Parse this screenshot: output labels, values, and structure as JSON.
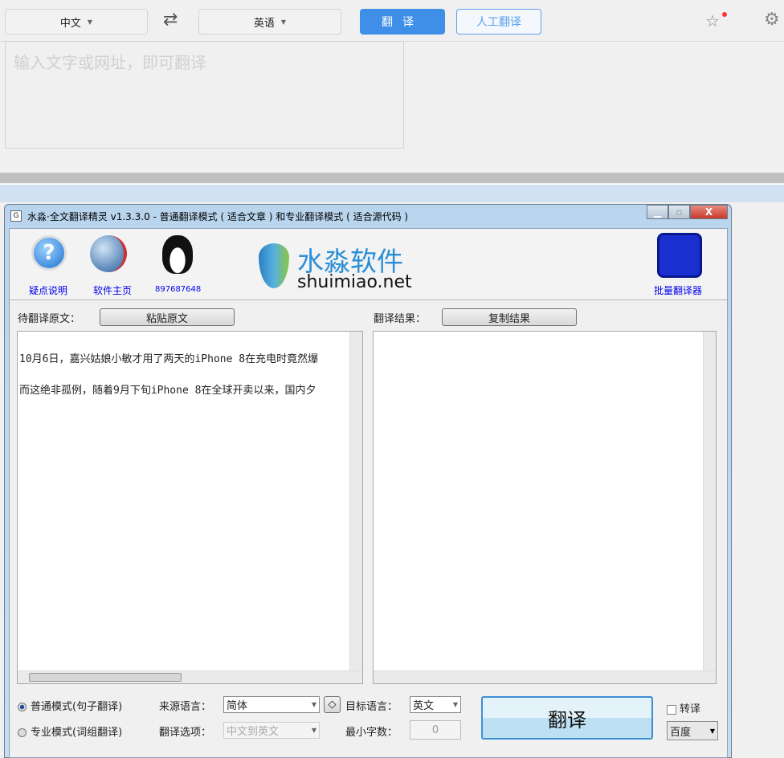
{
  "top": {
    "src_lang": "中文",
    "tgt_lang": "英语",
    "translate": "翻译",
    "human_translate": "人工翻译",
    "placeholder": "输入文字或网址，即可翻译"
  },
  "window": {
    "title": "水淼·全文翻译精灵 v1.3.3.0 - 普通翻译模式 ( 适合文章 ) 和专业翻译模式 ( 适合源代码 )",
    "close": "X",
    "links": {
      "help": "疑点说明",
      "home": "软件主页",
      "qq": "897687648",
      "batch": "批量翻译器"
    },
    "logo": {
      "cn": "水淼软件",
      "en": "shuimiao.net"
    },
    "source_label": "待翻译原文：",
    "paste": "粘贴原文",
    "result_label": "翻译结果：",
    "copy": "复制结果",
    "source_lines": [
      "10月6日，嘉兴姑娘小敏才用了两天的iPhone 8在充电时竟然爆",
      "而这绝非孤例，随着9月下旬iPhone 8在全球开卖以来，国内夕"
    ],
    "mode_normal": "普通模式(句子翻译)",
    "mode_pro": "专业模式(词组翻译)",
    "src_lang_label": "来源语言：",
    "src_lang": "简体",
    "swap": "◇",
    "tgt_lang_label": "目标语言：",
    "tgt_lang": "英文",
    "option_label": "翻译选项：",
    "option": "中文到英文",
    "min_chars_label": "最小字数：",
    "min_chars": "0",
    "translate": "翻译",
    "transliterate": "转译",
    "engine": "百度"
  }
}
